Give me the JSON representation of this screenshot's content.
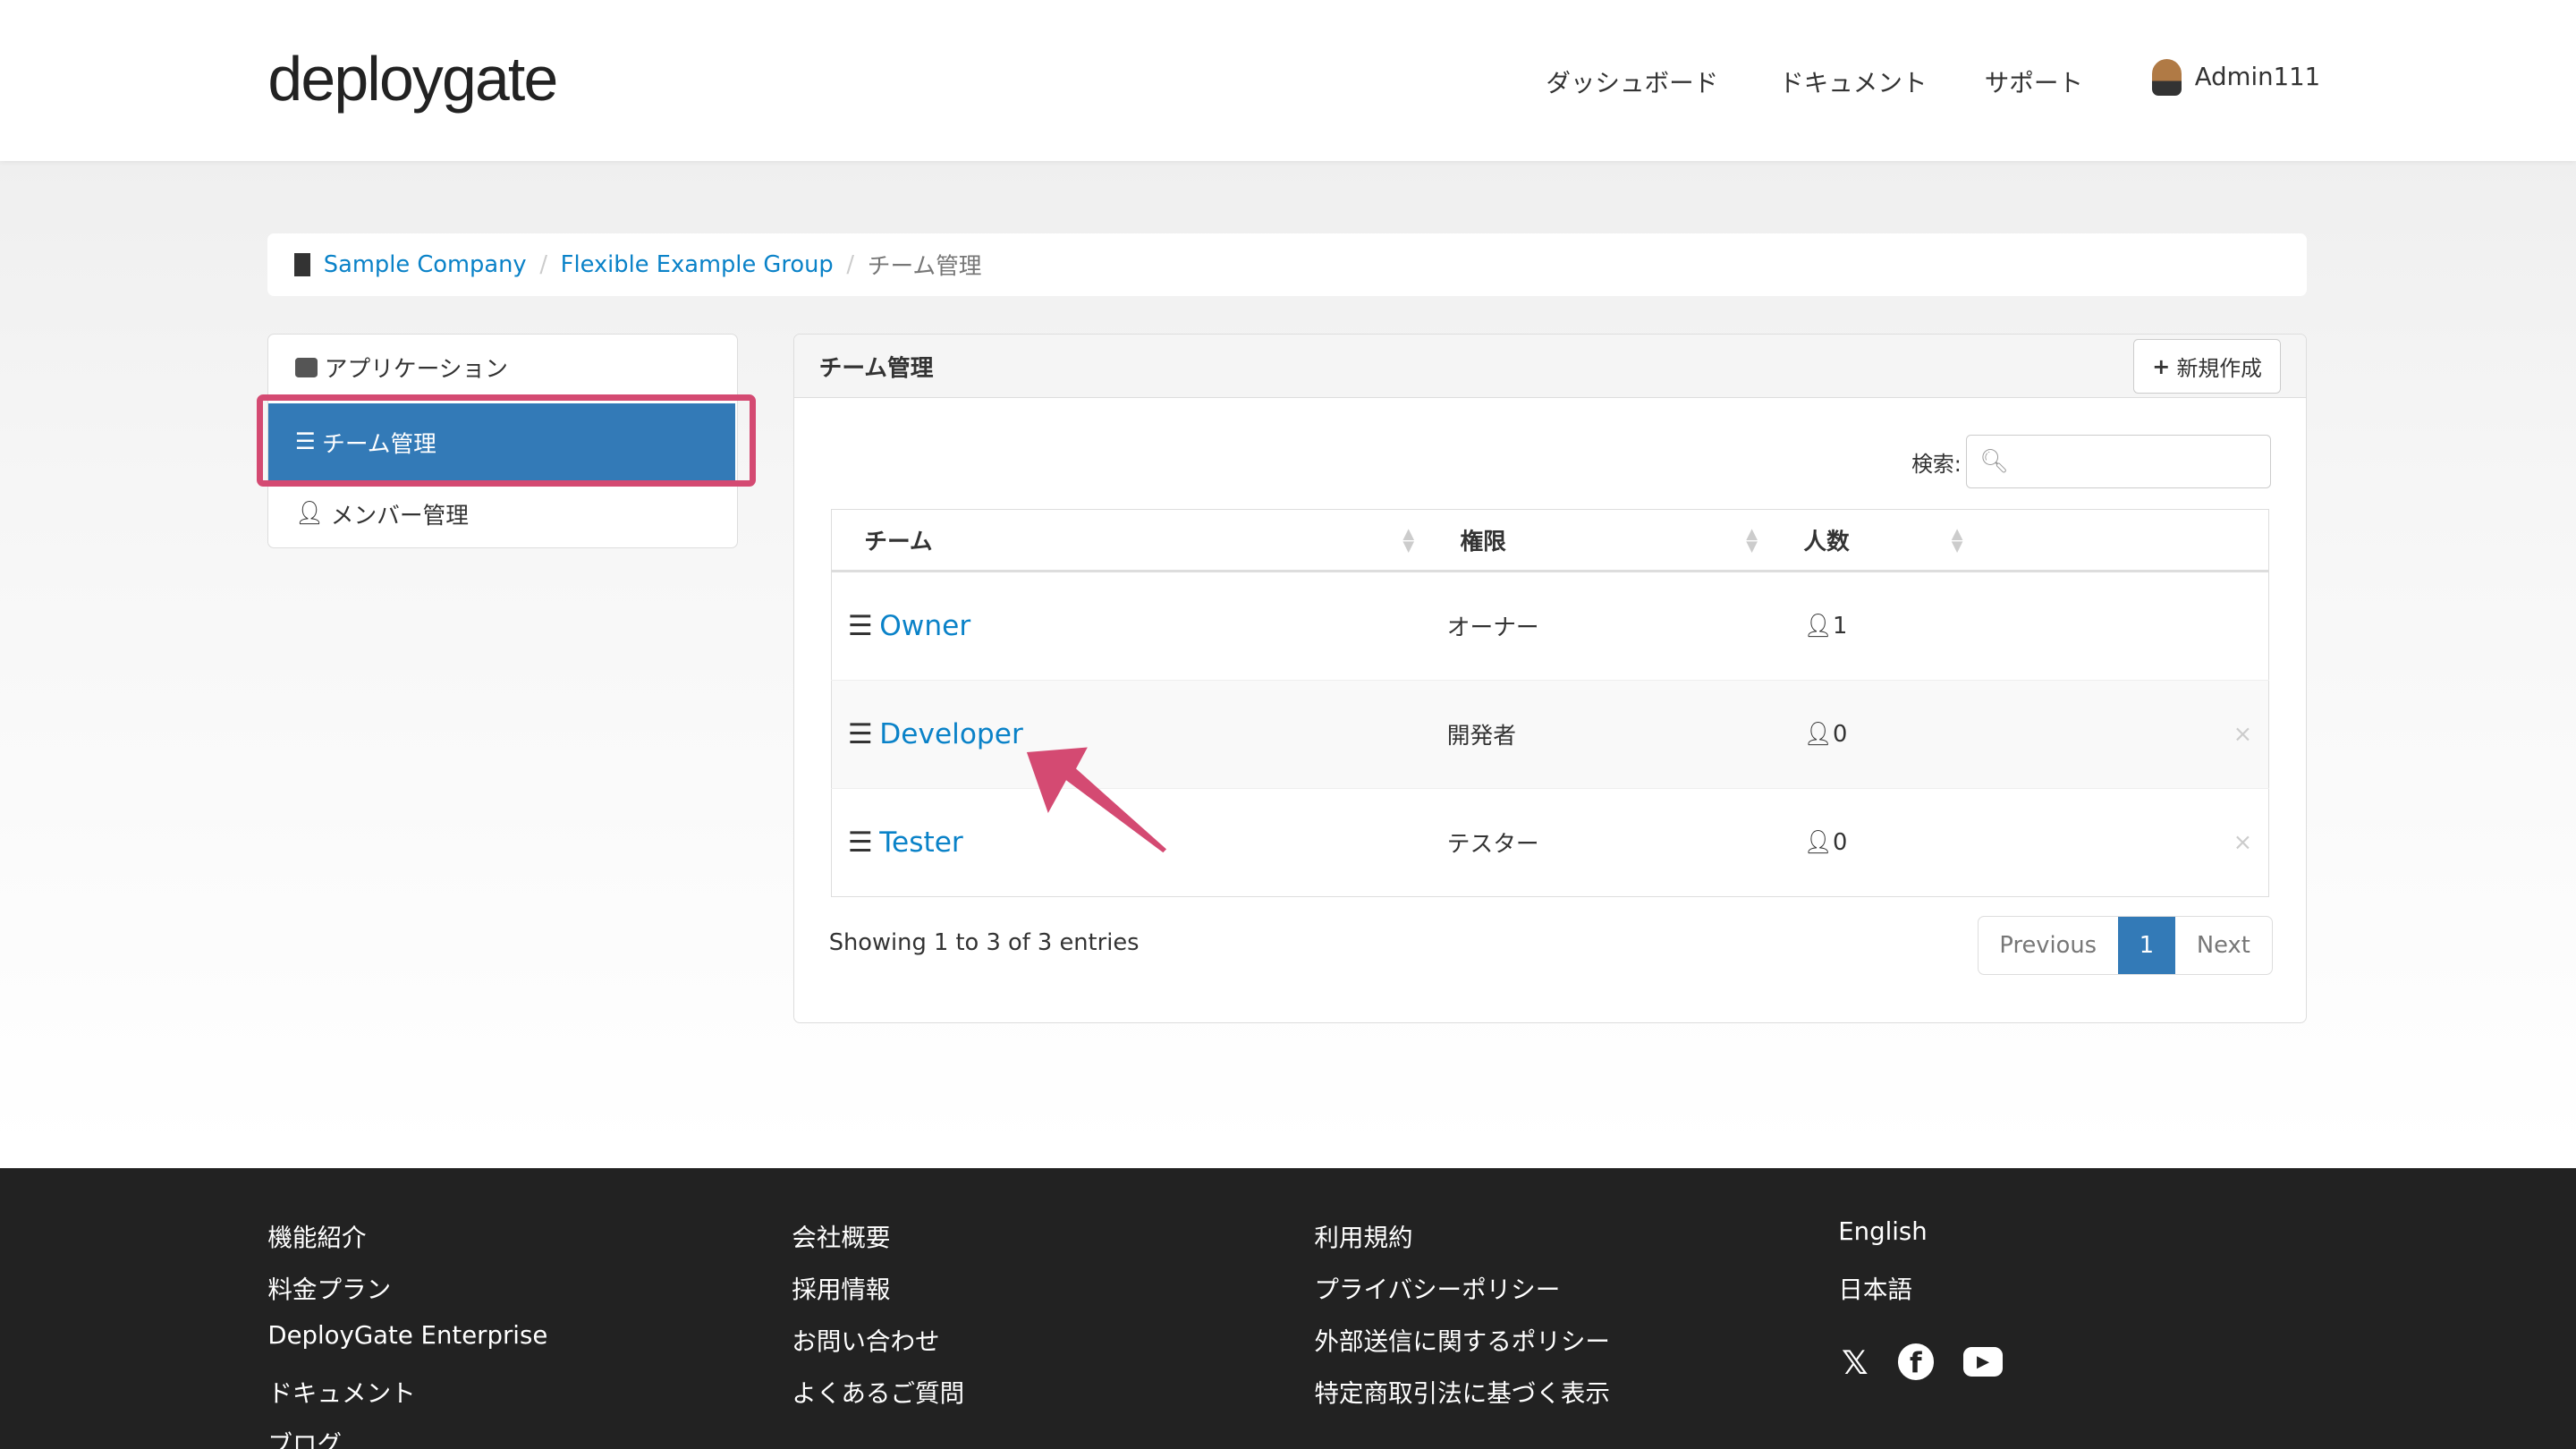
{
  "header": {
    "logo": "deploygate",
    "nav": [
      "ダッシュボード",
      "ドキュメント",
      "サポート"
    ],
    "user": "Admin111"
  },
  "breadcrumb": [
    "Sample Company",
    "Flexible Example Group",
    "チーム管理"
  ],
  "sidebar": {
    "items": [
      {
        "label": "アプリケーション",
        "icon": "server-icon"
      },
      {
        "label": "チーム管理",
        "icon": "list-icon",
        "active": true
      },
      {
        "label": "メンバー管理",
        "icon": "user-icon"
      }
    ]
  },
  "panel": {
    "title": "チーム管理",
    "new_button": "新規作成",
    "search_label": "検索:",
    "search_value": "",
    "columns": [
      "チーム",
      "権限",
      "人数"
    ],
    "rows": [
      {
        "team": "Owner",
        "role": "オーナー",
        "members": "1",
        "deletable": false
      },
      {
        "team": "Developer",
        "role": "開発者",
        "members": "0",
        "deletable": true
      },
      {
        "team": "Tester",
        "role": "テスター",
        "members": "0",
        "deletable": true
      }
    ],
    "info": "Showing 1 to 3 of 3 entries",
    "pagination": {
      "previous": "Previous",
      "current": "1",
      "next": "Next"
    }
  },
  "footer": {
    "col1": [
      "機能紹介",
      "料金プラン",
      "DeployGate Enterprise",
      "ドキュメント",
      "ブログ"
    ],
    "col2": [
      "会社概要",
      "採用情報",
      "お問い合わせ",
      "よくあるご質問"
    ],
    "col3": [
      "利用規約",
      "プライバシーポリシー",
      "外部送信に関するポリシー",
      "特定商取引法に基づく表示"
    ],
    "col4": [
      "English",
      "日本語"
    ]
  },
  "colors": {
    "accent": "#337ab7",
    "link": "#0a82c8",
    "highlight": "#d44a72",
    "footer": "#222222"
  }
}
